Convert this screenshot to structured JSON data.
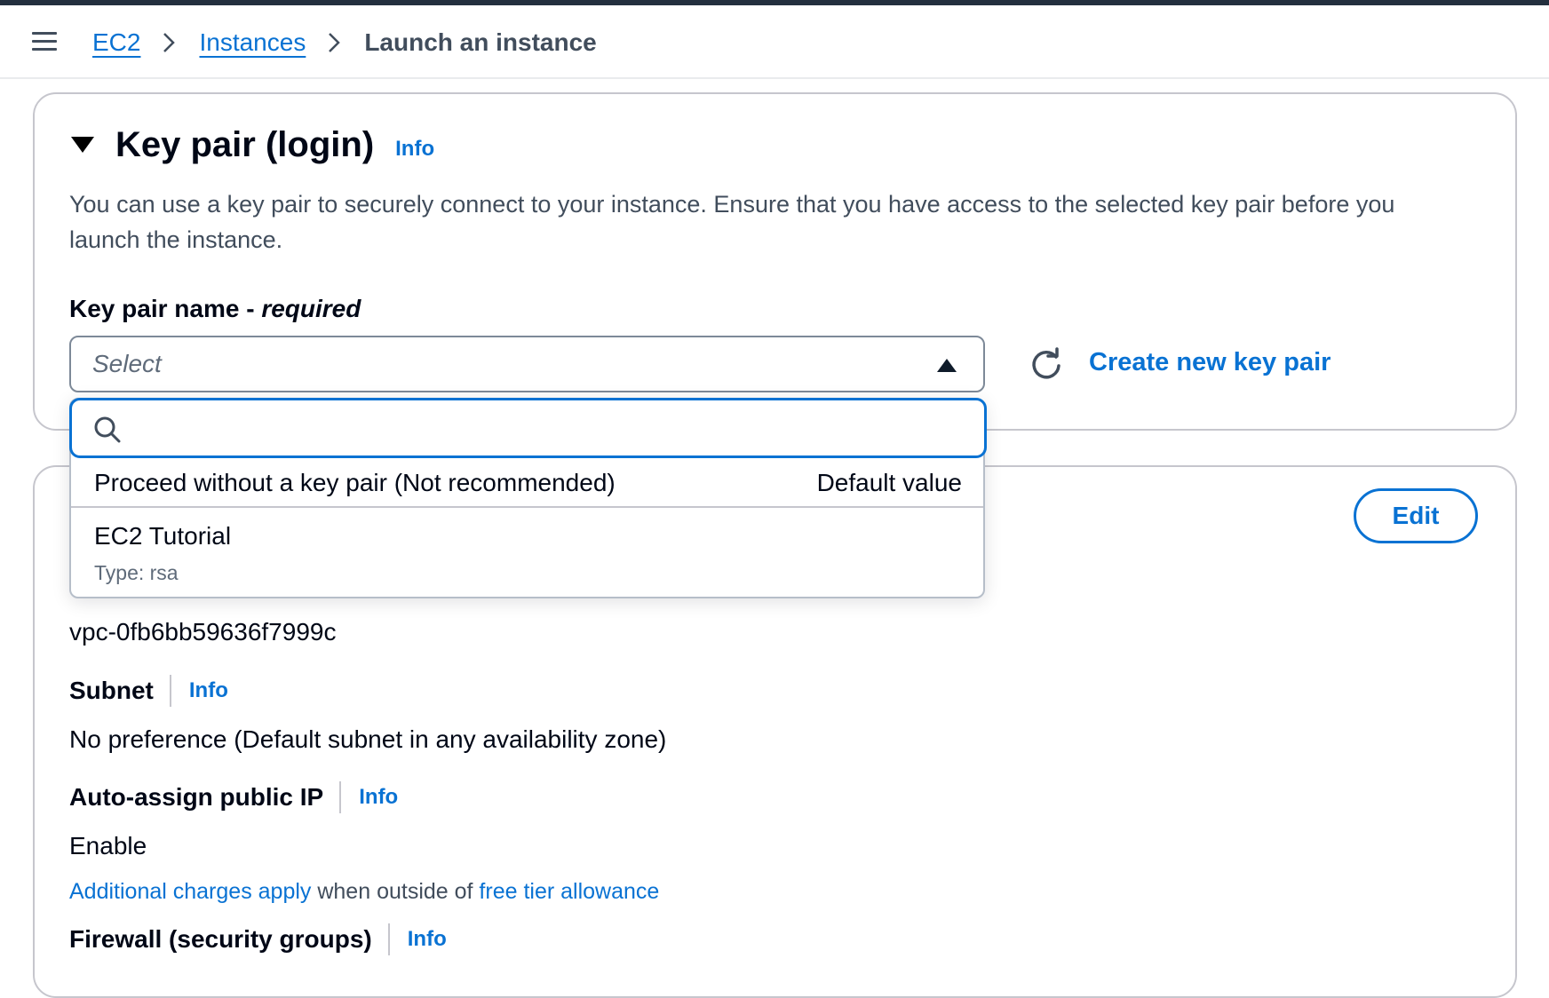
{
  "breadcrumb": {
    "items": [
      "EC2",
      "Instances"
    ],
    "current": "Launch an instance"
  },
  "key_pair": {
    "title": "Key pair (login)",
    "info": "Info",
    "description": "You can use a key pair to securely connect to your instance. Ensure that you have access to the selected key pair before you launch the instance.",
    "field_label": "Key pair name - ",
    "field_required": "required",
    "select_placeholder": "Select",
    "search_value": "",
    "create_link": "Create new key pair",
    "options": [
      {
        "label": "Proceed without a key pair (Not recommended)",
        "tag": "Default value"
      },
      {
        "label": "EC2 Tutorial",
        "sub": "Type: rsa"
      }
    ]
  },
  "network": {
    "edit_label": "Edit",
    "vpc_value": "vpc-0fb6bb59636f7999c",
    "subnet_label": "Subnet",
    "subnet_info": "Info",
    "subnet_value": "No preference (Default subnet in any availability zone)",
    "public_ip_label": "Auto-assign public IP",
    "public_ip_info": "Info",
    "public_ip_value": "Enable",
    "charges_link1": "Additional charges apply",
    "charges_middle": " when outside of ",
    "charges_link2": "free tier allowance",
    "firewall_label": "Firewall (security groups)",
    "firewall_info": "Info"
  },
  "colors": {
    "link": "#0972d3",
    "text": "#000716",
    "muted": "#5f6b7a",
    "border": "#c6c6cd"
  }
}
